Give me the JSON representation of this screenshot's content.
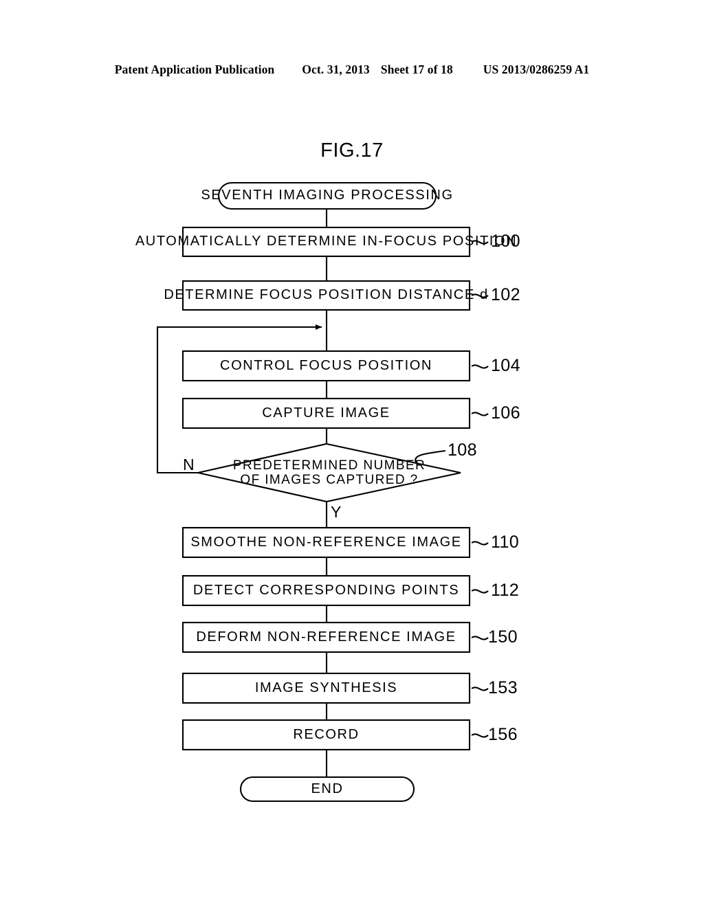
{
  "header": {
    "publication": "Patent Application Publication",
    "date": "Oct. 31, 2013",
    "sheet": "Sheet 17 of 18",
    "patent_number": "US 2013/0286259 A1"
  },
  "figure": {
    "title": "FIG.17"
  },
  "flowchart": {
    "start": {
      "label": "SEVENTH IMAGING PROCESSING",
      "shape": "rounded-terminal"
    },
    "end": {
      "label": "END",
      "shape": "rounded-terminal"
    },
    "steps": [
      {
        "label": "AUTOMATICALLY DETERMINE IN-FOCUS POSITION",
        "ref": "100",
        "shape": "process"
      },
      {
        "label": "DETERMINE FOCUS POSITION DISTANCE d",
        "ref": "102",
        "shape": "process"
      },
      {
        "label": "CONTROL FOCUS POSITION",
        "ref": "104",
        "shape": "process"
      },
      {
        "label": "CAPTURE IMAGE",
        "ref": "106",
        "shape": "process"
      },
      {
        "label": "SMOOTHE NON-REFERENCE IMAGE",
        "ref": "110",
        "shape": "process"
      },
      {
        "label": "DETECT CORRESPONDING POINTS",
        "ref": "112",
        "shape": "process"
      },
      {
        "label": "DEFORM NON-REFERENCE IMAGE",
        "ref": "150",
        "shape": "process"
      },
      {
        "label": "IMAGE SYNTHESIS",
        "ref": "153",
        "shape": "process"
      },
      {
        "label": "RECORD",
        "ref": "156",
        "shape": "process"
      }
    ],
    "decision": {
      "label_line1": "PREDETERMINED NUMBER",
      "label_line2": "OF IMAGES CAPTURED ?",
      "ref": "108",
      "shape": "diamond",
      "branch_no": "N",
      "branch_yes": "Y"
    },
    "colors": {
      "stroke": "#000000",
      "background": "#ffffff"
    }
  }
}
